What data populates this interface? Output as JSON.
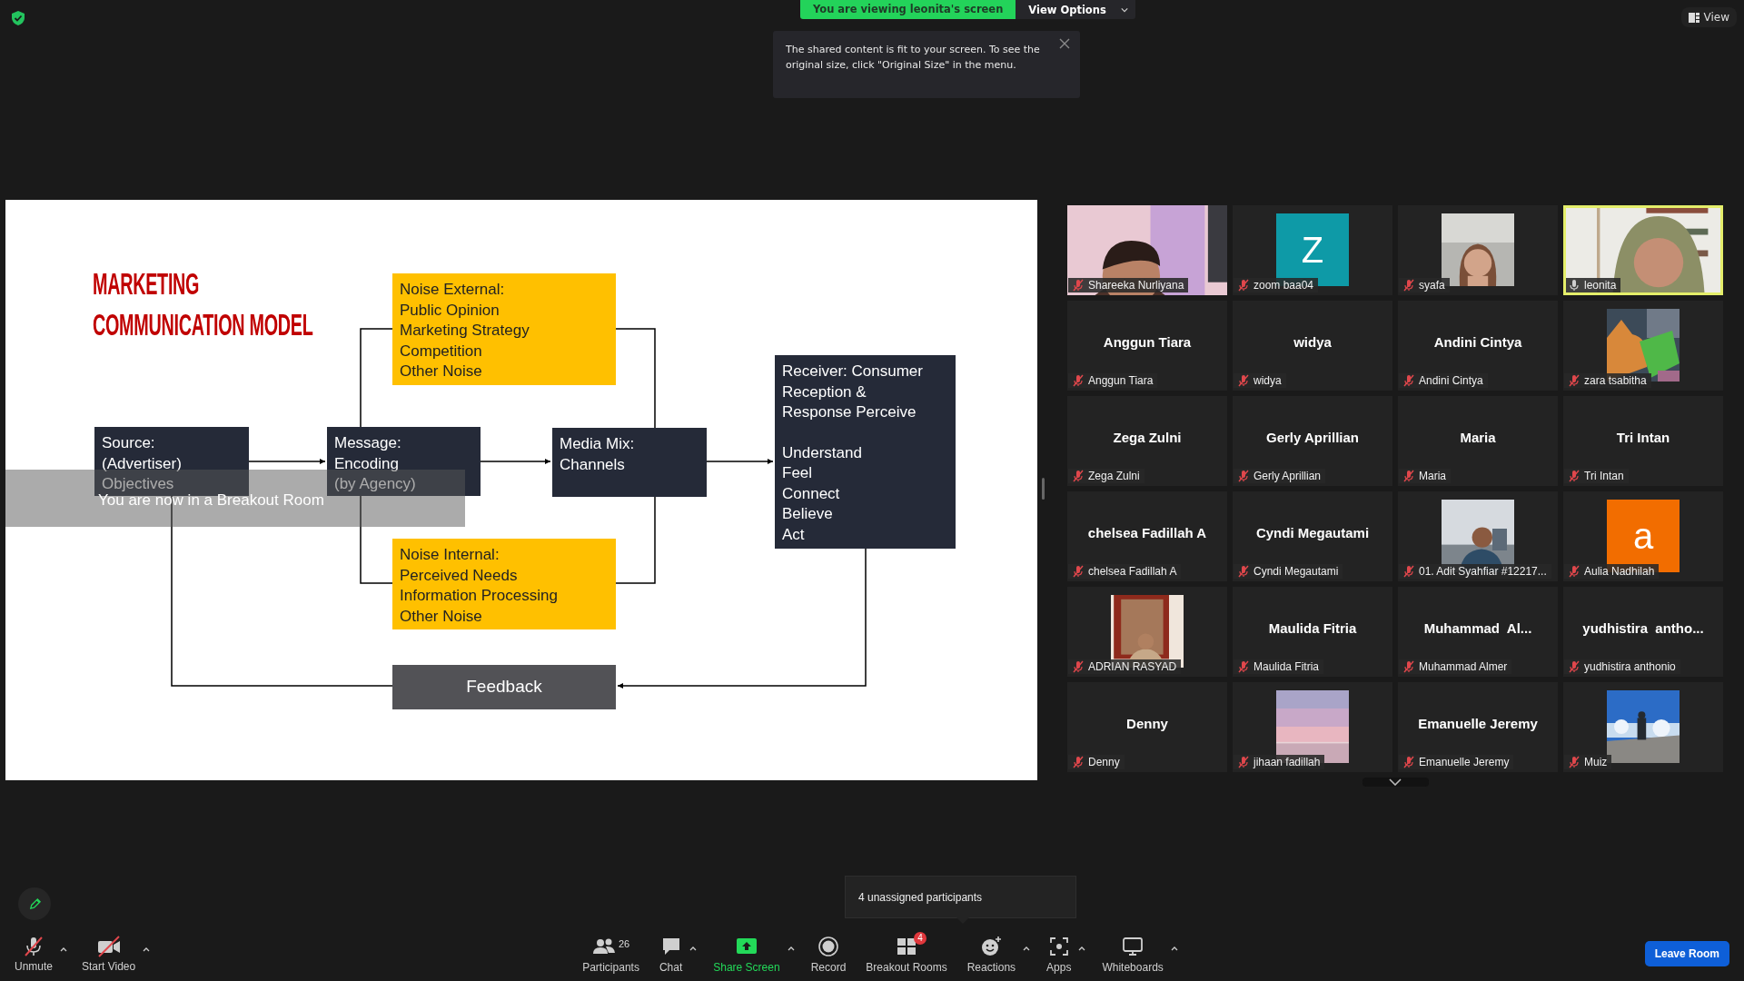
{
  "top_bar": {
    "viewing_banner": "You are viewing leonita's screen",
    "view_options": "View Options",
    "view_button": "View"
  },
  "tooltip": {
    "text": "The shared content is fit to your screen. To see the original size, click \"Original Size\" in the menu."
  },
  "slide": {
    "title_lines": [
      "MARKETING",
      "COMMUNICATION MODEL"
    ],
    "nodes": [
      {
        "kind": "noise",
        "paragraphs": [
          [
            "Noise External:",
            "Public Opinion",
            "Marketing Strategy",
            "Competition",
            "Other Noise"
          ]
        ]
      },
      {
        "kind": "dark",
        "paragraphs": [
          [
            "Source:",
            "(Advertiser)",
            "Objectives"
          ]
        ]
      },
      {
        "kind": "dark",
        "paragraphs": [
          [
            "Message:",
            "Encoding",
            "(by Agency)"
          ]
        ]
      },
      {
        "kind": "dark",
        "paragraphs": [
          [
            "Media Mix:",
            "Channels"
          ]
        ]
      },
      {
        "kind": "dark",
        "paragraphs": [
          [
            "Receiver: Consumer",
            "Reception &",
            "Response Perceive"
          ],
          [
            "Understand",
            "Feel",
            "Connect",
            "Believe",
            "Act"
          ]
        ]
      },
      {
        "kind": "noise",
        "paragraphs": [
          [
            "Noise Internal:",
            "Perceived Needs",
            "Information Processing",
            "Other Noise"
          ]
        ]
      },
      {
        "kind": "feedback",
        "paragraphs": [
          [
            "Feedback"
          ]
        ]
      }
    ],
    "breakout_notice": "You are now in a Breakout Room"
  },
  "participants": [
    {
      "kind": "video",
      "label": "Shareeka Nurliyana",
      "muted": true,
      "speaking": false
    },
    {
      "kind": "letter",
      "letter": "Z",
      "color": "#0e9aa7",
      "label": "zoom baa04",
      "muted": true,
      "speaking": false
    },
    {
      "label": "syafa",
      "muted": true,
      "speaking": false
    },
    {
      "kind": "video",
      "label": "leonita",
      "muted": false,
      "speaking": true
    },
    {
      "kind": "name",
      "display_name": "Anggun Tiara",
      "label": "Anggun Tiara",
      "muted": true,
      "speaking": false
    },
    {
      "kind": "name",
      "display_name": "widya",
      "label": "widya",
      "muted": true,
      "speaking": false
    },
    {
      "kind": "name",
      "display_name": "Andini Cintya",
      "label": "Andini Cintya",
      "muted": true,
      "speaking": false
    },
    {
      "label": "zara tsabitha",
      "muted": true,
      "speaking": false
    },
    {
      "kind": "name",
      "display_name": "Zega Zulni",
      "label": "Zega Zulni",
      "muted": true,
      "speaking": false
    },
    {
      "kind": "name",
      "display_name": "Gerly Aprillian",
      "label": "Gerly Aprillian",
      "muted": true,
      "speaking": false
    },
    {
      "kind": "name",
      "display_name": "Maria",
      "label": "Maria",
      "muted": true,
      "speaking": false
    },
    {
      "kind": "name",
      "display_name": "Tri Intan",
      "label": "Tri Intan",
      "muted": true,
      "speaking": false
    },
    {
      "kind": "name",
      "display_name": "chelsea Fadillah A",
      "label": "chelsea Fadillah A",
      "muted": true,
      "speaking": false
    },
    {
      "kind": "name",
      "display_name": "Cyndi Megautami",
      "label": "Cyndi Megautami",
      "muted": true,
      "speaking": false
    },
    {
      "label": "01. Adit Syahfiar #12217...",
      "muted": true,
      "speaking": false
    },
    {
      "kind": "letter",
      "letter": "a",
      "color": "#f26d00",
      "label": "Aulia Nadhilah",
      "muted": true,
      "speaking": false
    },
    {
      "label": "ADRIAN RASYAD",
      "muted": true,
      "speaking": false
    },
    {
      "kind": "name",
      "display_name": "Maulida Fitria",
      "label": "Maulida Fitria",
      "muted": true,
      "speaking": false
    },
    {
      "kind": "name",
      "display_name": "Muhammad  Al...",
      "label": "Muhammad Almer",
      "muted": true,
      "speaking": false
    },
    {
      "kind": "name",
      "display_name": "yudhistira  antho...",
      "label": "yudhistira anthonio",
      "muted": true,
      "speaking": false
    },
    {
      "kind": "name",
      "display_name": "Denny",
      "label": "Denny",
      "muted": true,
      "speaking": false
    },
    {
      "label": "jihaan fadillah",
      "muted": true,
      "speaking": false
    },
    {
      "kind": "name",
      "display_name": "Emanuelle Jeremy",
      "label": "Emanuelle Jeremy",
      "muted": true,
      "speaking": false
    },
    {
      "label": "Muiz",
      "muted": true,
      "speaking": false
    }
  ],
  "toast": "4 unassigned participants",
  "toolbar_left": [
    {
      "kind": "mic-off",
      "label": "Unmute",
      "caret": true
    },
    {
      "kind": "video-off",
      "label": "Start Video",
      "caret": true
    }
  ],
  "toolbar_center": [
    {
      "kind": "participants",
      "label": "Participants",
      "count": "26",
      "caret": false
    },
    {
      "kind": "chat",
      "label": "Chat",
      "caret": true
    },
    {
      "kind": "share",
      "label": "Share Screen",
      "caret": true
    },
    {
      "kind": "record",
      "label": "Record",
      "caret": false
    },
    {
      "kind": "breakout",
      "label": "Breakout Rooms",
      "badge": "4",
      "caret": false
    },
    {
      "kind": "reactions",
      "label": "Reactions",
      "caret": true
    },
    {
      "kind": "apps",
      "label": "Apps",
      "caret": true
    },
    {
      "kind": "whiteboards",
      "label": "Whiteboards",
      "caret": true
    }
  ],
  "leave_button": "Leave Room"
}
